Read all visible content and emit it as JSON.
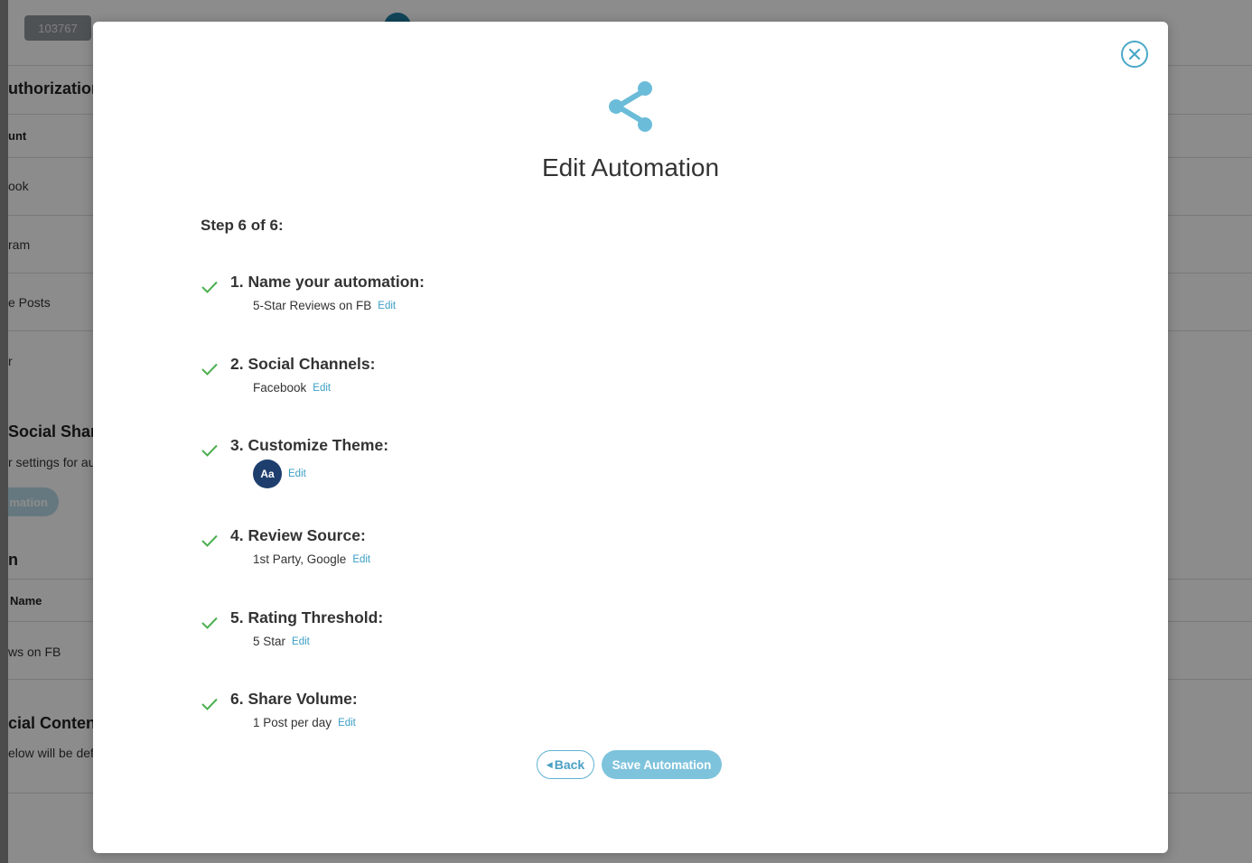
{
  "background": {
    "id_badge": "103767",
    "section_authorization": "uthorization",
    "col_account": "unt",
    "row_facebook": "ook",
    "row_instagram": "ram",
    "row_posts": "e Posts",
    "row_r": "r",
    "section_social_sharing": "Social Shari",
    "settings_text": "r settings for au",
    "pill_label": "mation",
    "section_n": "n",
    "col_name": "Name",
    "row_reviews": "ws on FB",
    "section_social_content": "cial Content",
    "below_text": "elow will be def"
  },
  "modal": {
    "title": "Edit Automation",
    "step_label": "Step 6 of 6:",
    "edit_label": "Edit",
    "steps": [
      {
        "title": "1. Name your automation:",
        "value": "5-Star Reviews on FB"
      },
      {
        "title": "2. Social Channels:",
        "value": "Facebook"
      },
      {
        "title": "3. Customize Theme:",
        "value": "Aa"
      },
      {
        "title": "4. Review Source:",
        "value": "1st Party, Google"
      },
      {
        "title": "5. Rating Threshold:",
        "value": "5 Star"
      },
      {
        "title": "6. Share Volume:",
        "value": "1 Post per day"
      }
    ],
    "back_label": "Back",
    "save_label": "Save Automation"
  },
  "colors": {
    "accent": "#4aa8c8",
    "check": "#4caf50",
    "theme_avatar": "#1e3f6e",
    "save_button": "#7ec3dc"
  },
  "icons": {
    "close": "close-icon",
    "share": "share-icon",
    "check": "check-icon",
    "back_chevron": "chevron-left-icon"
  }
}
